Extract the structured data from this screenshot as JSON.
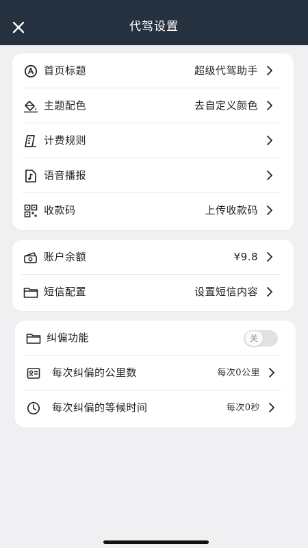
{
  "header": {
    "title": "代驾设置",
    "close_icon": "close-icon"
  },
  "colors": {
    "nav_bg": "#26313f",
    "page_bg": "#f0f0f2",
    "card_bg": "#ffffff"
  },
  "group1": {
    "items": [
      {
        "label": "首页标题",
        "value": "超级代驾助手",
        "icon": "home-title-icon"
      },
      {
        "label": "主题配色",
        "value": "去自定义颜色",
        "icon": "paint-bucket-icon"
      },
      {
        "label": "计费规则",
        "value": "",
        "icon": "ruler-icon"
      },
      {
        "label": "语音播报",
        "value": "",
        "icon": "audio-file-icon"
      },
      {
        "label": "收款码",
        "value": "上传收款码",
        "icon": "qr-code-icon"
      }
    ]
  },
  "group2": {
    "items": [
      {
        "label": "账户余额",
        "value": "¥9.8",
        "icon": "wallet-icon"
      },
      {
        "label": "短信配置",
        "value": "设置短信内容",
        "icon": "folder-icon"
      }
    ]
  },
  "group3": {
    "toggle": {
      "label": "纠偏功能",
      "state_label": "关",
      "on": false,
      "icon": "folder-icon"
    },
    "items": [
      {
        "label": "每次纠偏的公里数",
        "value": "每次0公里",
        "icon": "distance-card-icon"
      },
      {
        "label": "每次纠偏的等候时间",
        "value": "每次0秒",
        "icon": "clock-icon"
      }
    ]
  }
}
